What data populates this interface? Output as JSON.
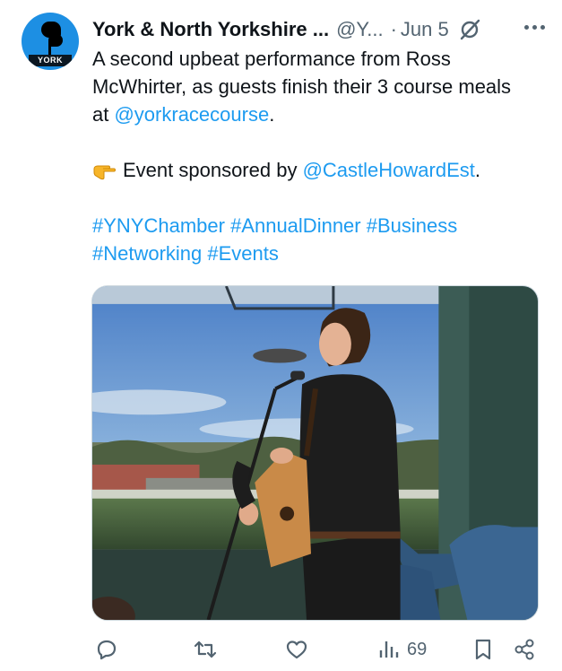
{
  "post": {
    "author_name": "York & North Yorkshire ...",
    "handle": "@Y...",
    "separator": "·",
    "date": "Jun 5",
    "avatar_text": "YORK",
    "body": {
      "line1": "A second upbeat performance from Ross",
      "line2": "McWhirter, as guests finish their 3 course meals",
      "line3_prefix": "at ",
      "line3_mention": "@yorkracecourse",
      "line3_suffix": ".",
      "sponsor_prefix": "Event sponsored by ",
      "sponsor_mention": "@CastleHowardEst",
      "sponsor_suffix": ".",
      "hashtags_line1": "#YNYChamber #AnnualDinner #Business",
      "hashtags_line2": "#Networking #Events"
    },
    "media": {
      "description_icon": "photo"
    },
    "actions": {
      "reply_icon": "reply-icon",
      "repost_icon": "repost-icon",
      "like_icon": "like-icon",
      "views_icon": "views-icon",
      "views_count": "69",
      "bookmark_icon": "bookmark-icon",
      "share_icon": "share-icon"
    },
    "colors": {
      "link": "#1d9bf0",
      "text": "#0f1419",
      "muted": "#536471",
      "avatar_bg": "#1d8fe3"
    }
  }
}
